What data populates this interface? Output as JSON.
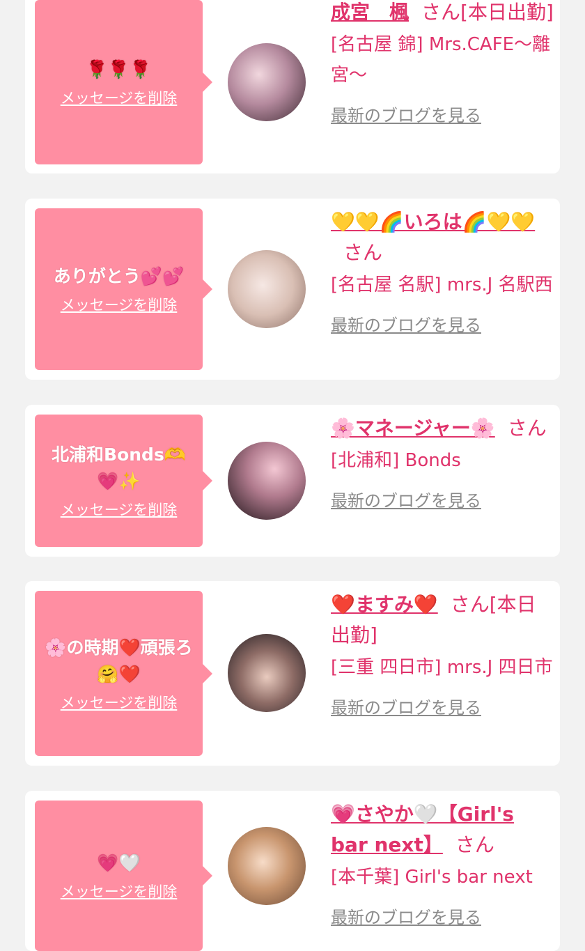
{
  "colors": {
    "accent": "#e0336b",
    "bubble": "#ff8ea2",
    "muted": "#8a8a8a"
  },
  "delete_label": "メッセージを削除",
  "blog_label": "最新のブログを見る",
  "items": [
    {
      "message": "🌹🌹🌹",
      "name": "成宮　楓",
      "suffix": "さん[本日出勤]",
      "shop": "[名古屋 錦] Mrs.CAFE～離宮～",
      "avatar_icon": "avatar-photo"
    },
    {
      "message": "ありがとう💕💕",
      "name": "💛💛🌈いろは🌈💛💛",
      "suffix": "さん",
      "shop": "[名古屋 名駅] mrs.J 名駅西",
      "avatar_icon": "avatar-photo"
    },
    {
      "message": "北浦和Bonds🫶💗✨",
      "name": "🌸マネージャー🌸",
      "suffix": "さん",
      "shop": "[北浦和] Bonds",
      "avatar_icon": "avatar-photo"
    },
    {
      "message": "🌸の時期❤️頑張ろ🤗❤️",
      "name": "❤️ますみ❤️",
      "suffix": "さん[本日出勤]",
      "shop": "[三重 四日市] mrs.J 四日市",
      "avatar_icon": "avatar-photo"
    },
    {
      "message": "💗🤍",
      "name": "💗さやか🤍【Girl's bar next】",
      "suffix": "さん",
      "shop": "[本千葉] Girl's bar next",
      "avatar_icon": "avatar-photo"
    }
  ]
}
